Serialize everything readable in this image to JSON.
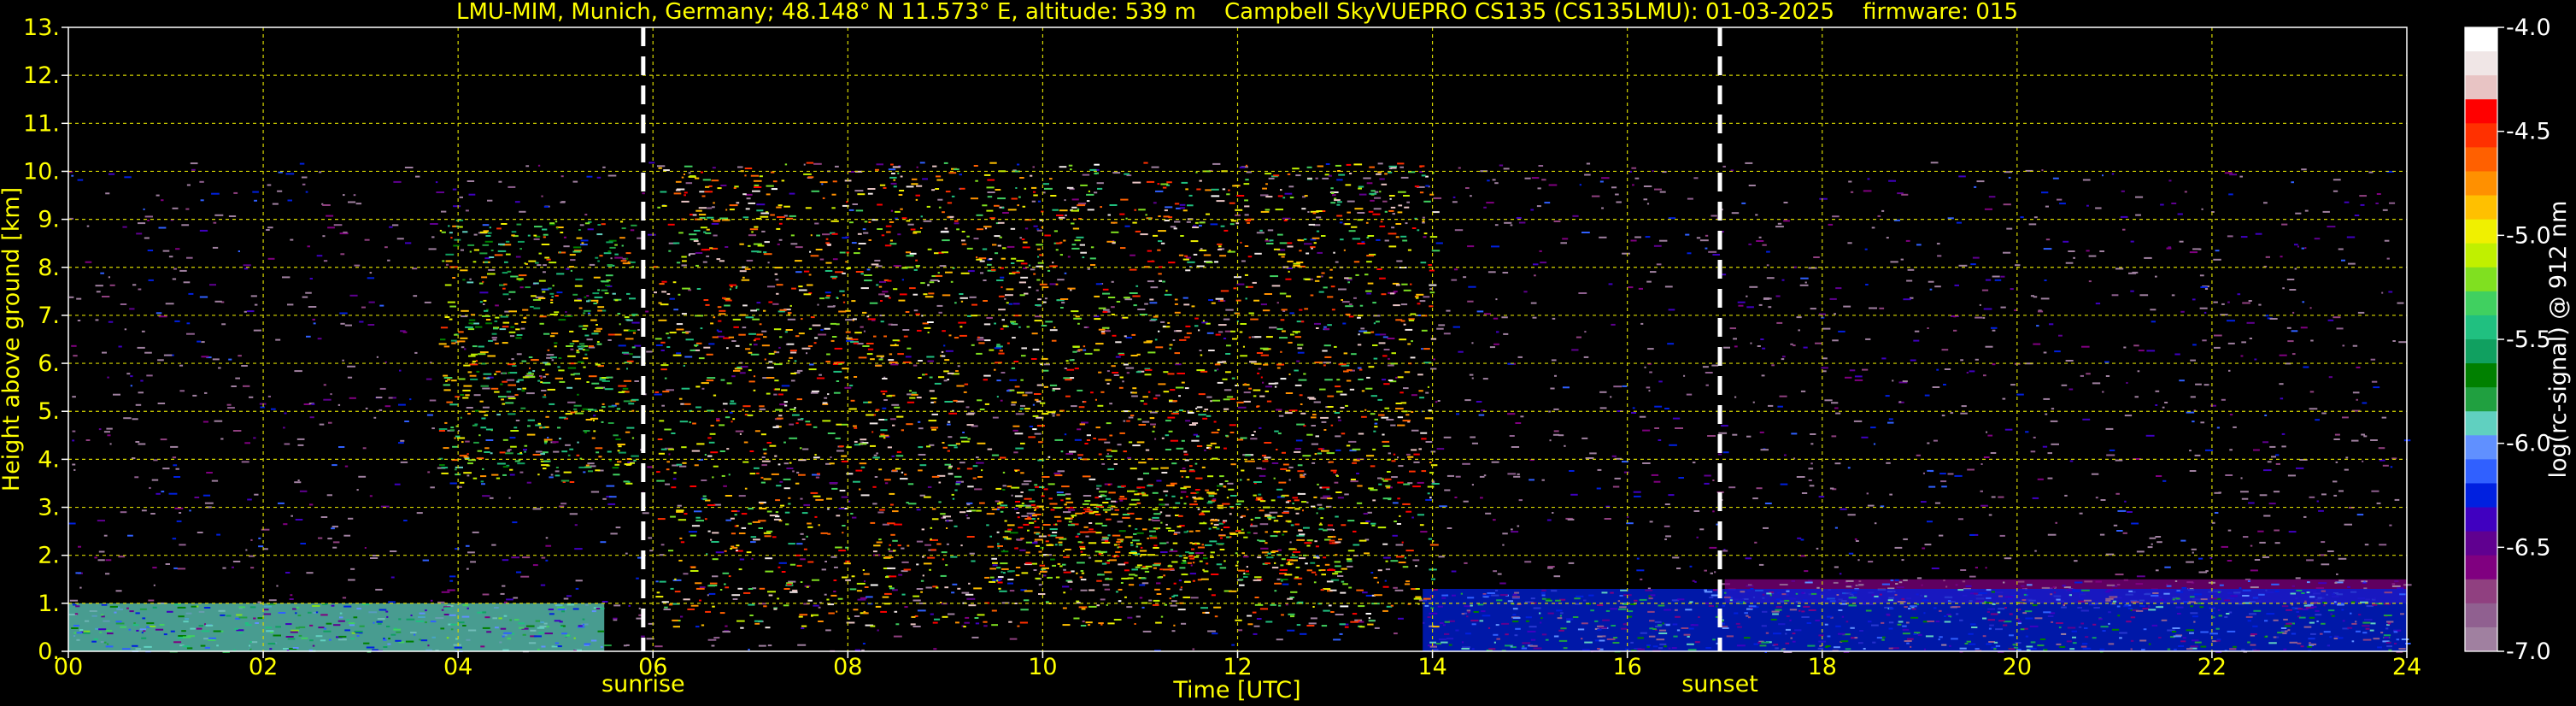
{
  "chart_data": {
    "type": "heatmap",
    "title": "LMU-MIM, Munich, Germany; 48.148° N 11.573° E, altitude: 539 m    Campbell SkyVUEPRO CS135 (CS135LMU): 01-03-2025    firmware: 015",
    "xlabel": "Time [UTC]",
    "ylabel": "Height above ground [km]",
    "xlim": [
      0,
      24
    ],
    "ylim": [
      0,
      13
    ],
    "x_ticks": [
      "00",
      "02",
      "04",
      "06",
      "08",
      "10",
      "12",
      "14",
      "16",
      "18",
      "20",
      "22",
      "24"
    ],
    "y_ticks": [
      "0.",
      "1.",
      "2.",
      "3.",
      "4.",
      "5.",
      "6.",
      "7.",
      "8.",
      "9.",
      "10.",
      "11.",
      "12.",
      "13."
    ],
    "grid": true,
    "markers": [
      {
        "label": "sunrise",
        "x": 5.9
      },
      {
        "label": "sunset",
        "x": 16.95
      }
    ],
    "colorbar": {
      "label": "log(rc-signal) @ 912 nm",
      "range": [
        -7.0,
        -4.0
      ],
      "ticks": [
        "-4.0",
        "-4.5",
        "-5.0",
        "-5.5",
        "-6.0",
        "-6.5",
        "-7.0"
      ],
      "colors": [
        "#ffffff",
        "#f0e6e6",
        "#e8c4c4",
        "#ff0000",
        "#ff3000",
        "#ff6000",
        "#ff9000",
        "#ffc000",
        "#f0f000",
        "#c0f000",
        "#80e020",
        "#40d060",
        "#20c080",
        "#10a060",
        "#008000",
        "#20a040",
        "#60d0c0",
        "#6090ff",
        "#3060ff",
        "#0020e0",
        "#4000c0",
        "#600090",
        "#800080",
        "#904080",
        "#906090",
        "#a080a0"
      ]
    },
    "data_regions": [
      {
        "feature": "stratified boundary layer aerosol",
        "x": [
          0,
          5.5
        ],
        "height_km": [
          0,
          1.0
        ],
        "level": -5.9
      },
      {
        "feature": "scattered cloud/aerosol streaks",
        "x": [
          3.8,
          5.8
        ],
        "height_km": [
          3.5,
          9.0
        ],
        "level": -5.2
      },
      {
        "feature": "daytime solar background noise",
        "x": [
          6,
          14
        ],
        "height_km": [
          0.5,
          10.2
        ],
        "level": -4.8
      },
      {
        "feature": "enhanced signal band",
        "x": [
          9.5,
          13
        ],
        "height_km": [
          1.5,
          3.5
        ],
        "level": -5.0
      },
      {
        "feature": "evening boundary layer",
        "x": [
          13.9,
          24
        ],
        "height_km": [
          0,
          1.3
        ],
        "level": -6.2
      },
      {
        "feature": "residual layer top",
        "x": [
          17,
          24
        ],
        "height_km": [
          1.0,
          1.5
        ],
        "level": -6.6
      },
      {
        "feature": "nighttime background",
        "x": [
          0,
          24
        ],
        "height_km": [
          0,
          10.2
        ],
        "level": -6.8
      }
    ]
  }
}
